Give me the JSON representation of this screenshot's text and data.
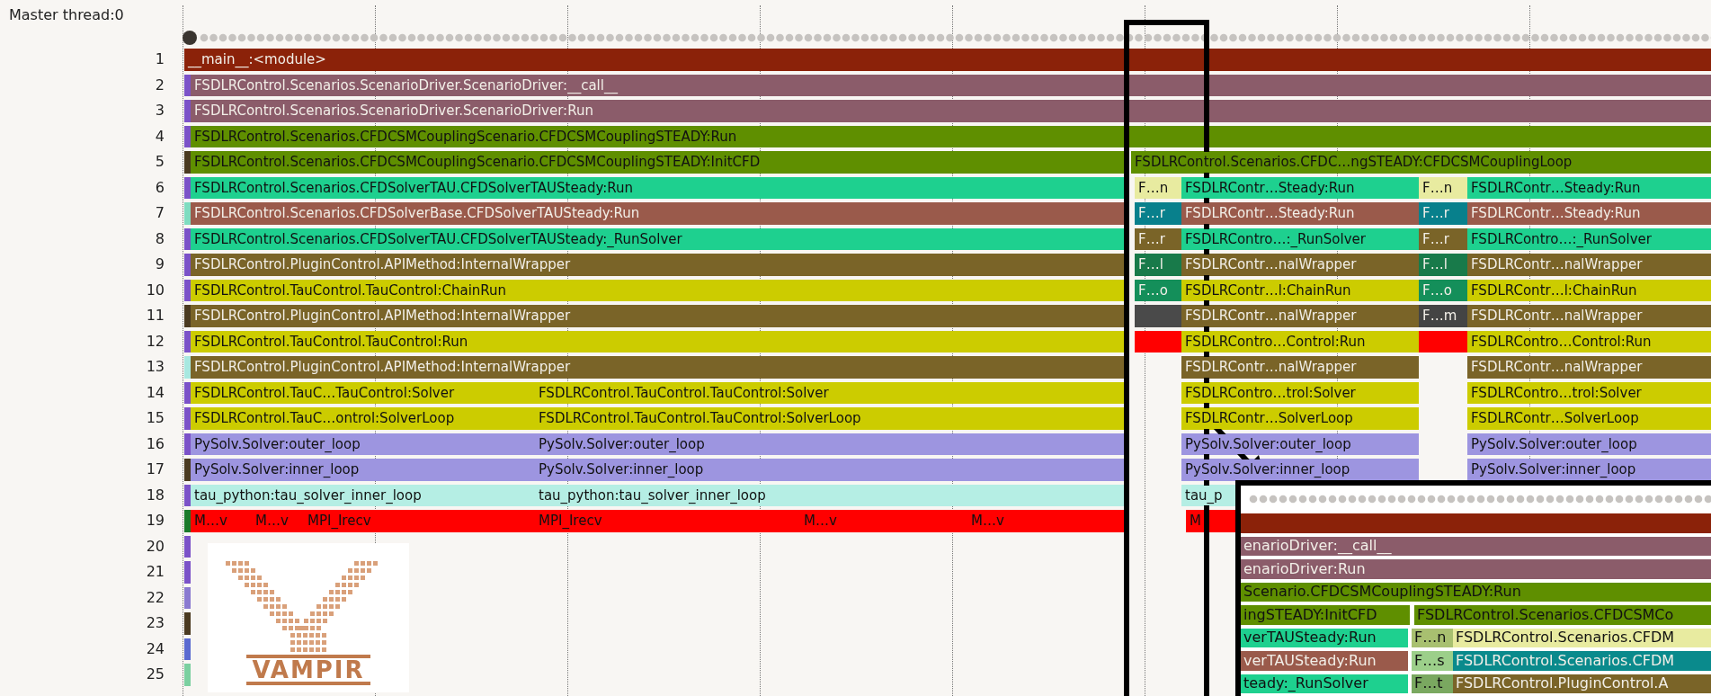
{
  "thread_label": "Master thread:0",
  "rows": [
    {
      "number": "1",
      "segments": [
        {
          "label": "__main__:<module>",
          "color": "#8b2209"
        }
      ]
    },
    {
      "number": "2",
      "segments": [
        {
          "color": "#7b52c8"
        },
        {
          "label": "FSDLRControl.Scenarios.ScenarioDriver.ScenarioDriver:__call__",
          "color": "#8b5c6a"
        }
      ]
    },
    {
      "number": "3",
      "segments": [
        {
          "color": "#7b52c8"
        },
        {
          "label": "FSDLRControl.Scenarios.ScenarioDriver.ScenarioDriver:Run",
          "color": "#8b5c6a"
        }
      ]
    },
    {
      "number": "4",
      "segments": [
        {
          "color": "#7b52c8"
        },
        {
          "label": "FSDLRControl.Scenarios.CFDCSMCouplingScenario.CFDCSMCouplingSTEADY:Run",
          "color": "#5f8f00"
        }
      ]
    },
    {
      "number": "5",
      "segments": [
        {
          "color": "#4a3a20"
        },
        {
          "label": "FSDLRControl.Scenarios.CFDCSMCouplingScenario.CFDCSMCouplingSTEADY:InitCFD",
          "color": "#5f8f00"
        },
        {
          "label": "FSDLRControl.Scenarios.CFDC…ngSTEADY:CFDCSMCouplingLoop",
          "color": "#5f8f00"
        }
      ]
    },
    {
      "number": "6",
      "segments": [
        {
          "color": "#7b52c8"
        },
        {
          "label": "FSDLRControl.Scenarios.CFDSolverTAU.CFDSolverTAUSteady:Run",
          "color": "#1ed08f"
        },
        {
          "label": "F…n",
          "color": "#e8eba0"
        },
        {
          "label": "FSDLRContr…Steady:Run",
          "color": "#1ed08f"
        },
        {
          "label": "F…n",
          "color": "#e8eba0"
        },
        {
          "label": "FSDLRContr…Steady:Run",
          "color": "#1ed08f"
        }
      ]
    },
    {
      "number": "7",
      "segments": [
        {
          "color": "#7fdcc0"
        },
        {
          "label": "FSDLRControl.Scenarios.CFDSolverBase.CFDSolverTAUSteady:Run",
          "color": "#9a5a4b"
        },
        {
          "label": "F…r",
          "color": "#08808c"
        },
        {
          "label": "FSDLRContr…Steady:Run",
          "color": "#9a5a4b"
        },
        {
          "label": "F…r",
          "color": "#08808c"
        },
        {
          "label": "FSDLRContr…Steady:Run",
          "color": "#9a5a4b"
        }
      ]
    },
    {
      "number": "8",
      "segments": [
        {
          "color": "#7b52c8"
        },
        {
          "label": "FSDLRControl.Scenarios.CFDSolverTAU.CFDSolverTAUSteady:_RunSolver",
          "color": "#1ed08f"
        },
        {
          "label": "F…r",
          "color": "#7a6428"
        },
        {
          "label": "FSDLRContro…:_RunSolver",
          "color": "#1ed08f"
        },
        {
          "label": "F…r",
          "color": "#7a6428"
        },
        {
          "label": "FSDLRContro…:_RunSolver",
          "color": "#1ed08f"
        }
      ]
    },
    {
      "number": "9",
      "segments": [
        {
          "color": "#7b52c8"
        },
        {
          "label": "FSDLRControl.PluginControl.APIMethod:InternalWrapper",
          "color": "#7a6428"
        },
        {
          "label": "F…l",
          "color": "#187a4a"
        },
        {
          "label": "FSDLRContr…nalWrapper",
          "color": "#7a6428"
        },
        {
          "label": "F…l",
          "color": "#187a4a"
        },
        {
          "label": "FSDLRContr…nalWrapper",
          "color": "#7a6428"
        }
      ]
    },
    {
      "number": "10",
      "segments": [
        {
          "color": "#7b52c8"
        },
        {
          "label": "FSDLRControl.TauControl.TauControl:ChainRun",
          "color": "#cccc00"
        },
        {
          "label": "F…o",
          "color": "#148f5a"
        },
        {
          "label": "FSDLRContr…l:ChainRun",
          "color": "#cccc00"
        },
        {
          "label": "F…o",
          "color": "#148f5a"
        },
        {
          "label": "FSDLRContr…l:ChainRun",
          "color": "#cccc00"
        }
      ]
    },
    {
      "number": "11",
      "segments": [
        {
          "color": "#4a3a20"
        },
        {
          "label": "FSDLRControl.PluginControl.APIMethod:InternalWrapper",
          "color": "#7a6428"
        },
        {
          "color": "#4a4a4a"
        },
        {
          "label": "FSDLRContr…nalWrapper",
          "color": "#7a6428"
        },
        {
          "label": "F…m",
          "color": "#444444"
        },
        {
          "label": "FSDLRContr…nalWrapper",
          "color": "#7a6428"
        }
      ]
    },
    {
      "number": "12",
      "segments": [
        {
          "color": "#7b52c8"
        },
        {
          "label": "FSDLRControl.TauControl.TauControl:Run",
          "color": "#cccc00"
        },
        {
          "color": "#ff0000"
        },
        {
          "label": "FSDLRContro…Control:Run",
          "color": "#cccc00"
        },
        {
          "color": "#ff0000"
        },
        {
          "label": "FSDLRContro…Control:Run",
          "color": "#cccc00"
        }
      ]
    },
    {
      "number": "13",
      "segments": [
        {
          "color": "#a8e8e0"
        },
        {
          "label": "FSDLRControl.PluginControl.APIMethod:InternalWrapper",
          "color": "#7a6428"
        },
        {
          "label": "FSDLRContr…nalWrapper",
          "color": "#7a6428"
        },
        {
          "label": "FSDLRContr…nalWrapper",
          "color": "#7a6428"
        }
      ]
    },
    {
      "number": "14",
      "segments": [
        {
          "color": "#7b52c8"
        },
        {
          "label": "FSDLRControl.TauC…TauControl:Solver",
          "color": "#cccc00"
        },
        {
          "label": "FSDLRControl.TauControl.TauControl:Solver",
          "color": "#cccc00"
        },
        {
          "label": "FSDLRContro…trol:Solver",
          "color": "#cccc00"
        },
        {
          "label": "FSDLRContro…trol:Solver",
          "color": "#cccc00"
        }
      ]
    },
    {
      "number": "15",
      "segments": [
        {
          "color": "#7b52c8"
        },
        {
          "label": "FSDLRControl.TauC…ontrol:SolverLoop",
          "color": "#cccc00"
        },
        {
          "label": "FSDLRControl.TauControl.TauControl:SolverLoop",
          "color": "#cccc00"
        },
        {
          "label": "FSDLRContr…SolverLoop",
          "color": "#cccc00"
        },
        {
          "label": "FSDLRContr…SolverLoop",
          "color": "#cccc00"
        }
      ]
    },
    {
      "number": "16",
      "segments": [
        {
          "color": "#7b52c8"
        },
        {
          "label": "PySolv.Solver:outer_loop",
          "color": "#9d95e0"
        },
        {
          "label": "PySolv.Solver:outer_loop",
          "color": "#9d95e0"
        },
        {
          "label": "PySolv.Solver:outer_loop",
          "color": "#9d95e0"
        },
        {
          "label": "PySolv.Solver:outer_loop",
          "color": "#9d95e0"
        }
      ]
    },
    {
      "number": "17",
      "segments": [
        {
          "color": "#4a3a20"
        },
        {
          "label": "PySolv.Solver:inner_loop",
          "color": "#9d95e0"
        },
        {
          "label": "PySolv.Solver:inner_loop",
          "color": "#9d95e0"
        },
        {
          "label": "PySolv.Solver:inner_loop",
          "color": "#9d95e0"
        },
        {
          "label": "PySolv.Solver:inner_loop",
          "color": "#9d95e0"
        }
      ]
    },
    {
      "number": "18",
      "segments": [
        {
          "color": "#7b52c8"
        },
        {
          "label": "tau_python:tau_solver_inner_loop",
          "color": "#b5eee4"
        },
        {
          "label": "tau_python:tau_solver_inner_loop",
          "color": "#b5eee4"
        },
        {
          "label": "tau_p",
          "color": "#b5eee4"
        }
      ]
    },
    {
      "number": "19",
      "segments": [
        {
          "color": "#1a7a2a"
        },
        {
          "label": "M…v",
          "color": "#ff0000"
        },
        {
          "label": "M…v",
          "color": "#ff0000"
        },
        {
          "label": "MPI_Irecv",
          "color": "#ff0000"
        },
        {
          "label": "MPI_Irecv",
          "color": "#ff0000"
        },
        {
          "label": "M…v",
          "color": "#ff0000"
        },
        {
          "label": "M…v",
          "color": "#ff0000"
        },
        {
          "label": "M",
          "color": "#ff0000"
        }
      ]
    },
    {
      "number": "20",
      "segments": [
        {
          "color": "#7b52c8"
        }
      ]
    },
    {
      "number": "21",
      "segments": [
        {
          "color": "#7b52c8"
        }
      ]
    },
    {
      "number": "22",
      "segments": [
        {
          "color": "#8a7ad0"
        }
      ]
    },
    {
      "number": "23",
      "segments": [
        {
          "color": "#4a3a20"
        }
      ]
    },
    {
      "number": "24",
      "segments": [
        {
          "color": "#5a6ad0"
        }
      ]
    },
    {
      "number": "25",
      "segments": [
        {
          "color": "#7bd0a0"
        }
      ]
    }
  ],
  "inset": {
    "rows": [
      {
        "segments": [
          {
            "color": "#8b2209"
          }
        ]
      },
      {
        "segments": [
          {
            "label": "enarioDriver:__call__",
            "color": "#8b5c6a"
          }
        ]
      },
      {
        "segments": [
          {
            "label": "enarioDriver:Run",
            "color": "#8b5c6a"
          }
        ]
      },
      {
        "segments": [
          {
            "label": "Scenario.CFDCSMCouplingSTEADY:Run",
            "color": "#5f8f00"
          }
        ]
      },
      {
        "segments": [
          {
            "label": "ingSTEADY:InitCFD",
            "color": "#5f8f00"
          },
          {
            "label": "FSDLRControl.Scenarios.CFDCSMCo",
            "color": "#5f8f00"
          }
        ]
      },
      {
        "segments": [
          {
            "label": "verTAUSteady:Run",
            "color": "#1ed08f"
          },
          {
            "label": "F…n",
            "color": "#a8c070"
          },
          {
            "label": "FSDLRControl.Scenarios.CFDM",
            "color": "#e8eba0"
          }
        ]
      },
      {
        "segments": [
          {
            "label": "verTAUSteady:Run",
            "color": "#9a5a4b"
          },
          {
            "label": "F…s",
            "color": "#9ccf8a"
          },
          {
            "label": "FSDLRControl.Scenarios.CFDM",
            "color": "#0a8a8c"
          }
        ]
      },
      {
        "segments": [
          {
            "label": "teady:_RunSolver",
            "color": "#1ed08f"
          },
          {
            "label": "F…t",
            "color": "#7aa860"
          },
          {
            "label": "FSDLRControl.PluginControl.A",
            "color": "#7a6428"
          }
        ]
      }
    ]
  },
  "logo": {
    "text": "VAMPIR"
  }
}
